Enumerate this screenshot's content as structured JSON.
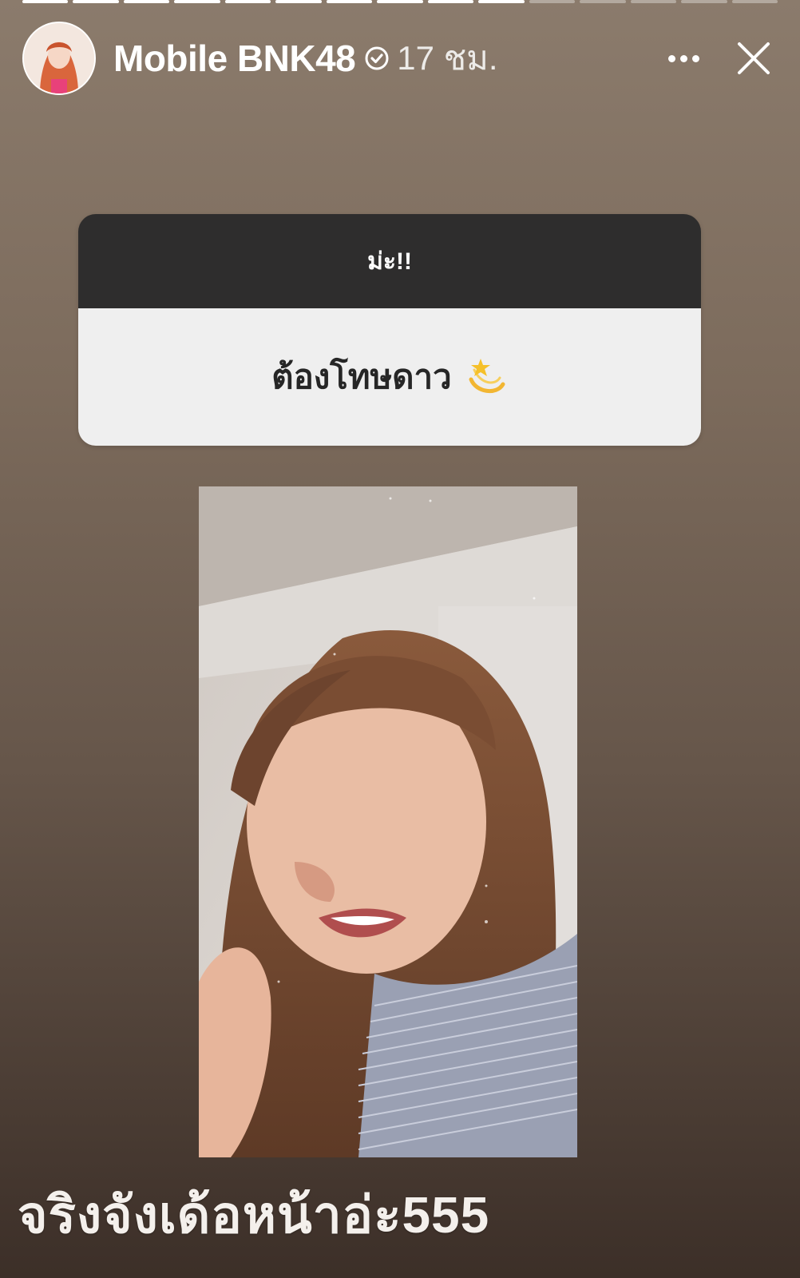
{
  "story": {
    "progress_segments_total": 15,
    "progress_segments_viewed": 10
  },
  "header": {
    "username": "Mobile BNK48",
    "verified_icon": "verified-check-icon",
    "time_ago": "17 ชม.",
    "more_icon": "more-horizontal-icon",
    "close_icon": "close-icon"
  },
  "question_sticker": {
    "question": "ม่ะ!!",
    "answer": "ต้องโทษดาว",
    "answer_emoji_icon": "shooting-star-icon"
  },
  "media": {
    "type": "selfie-video-frame"
  },
  "caption": {
    "text": "จริงจังเด้อหน้าอ่ะ555"
  },
  "colors": {
    "question_header_bg": "#2e2d2d",
    "question_body_bg": "#efefef",
    "text_primary": "#ffffff"
  }
}
